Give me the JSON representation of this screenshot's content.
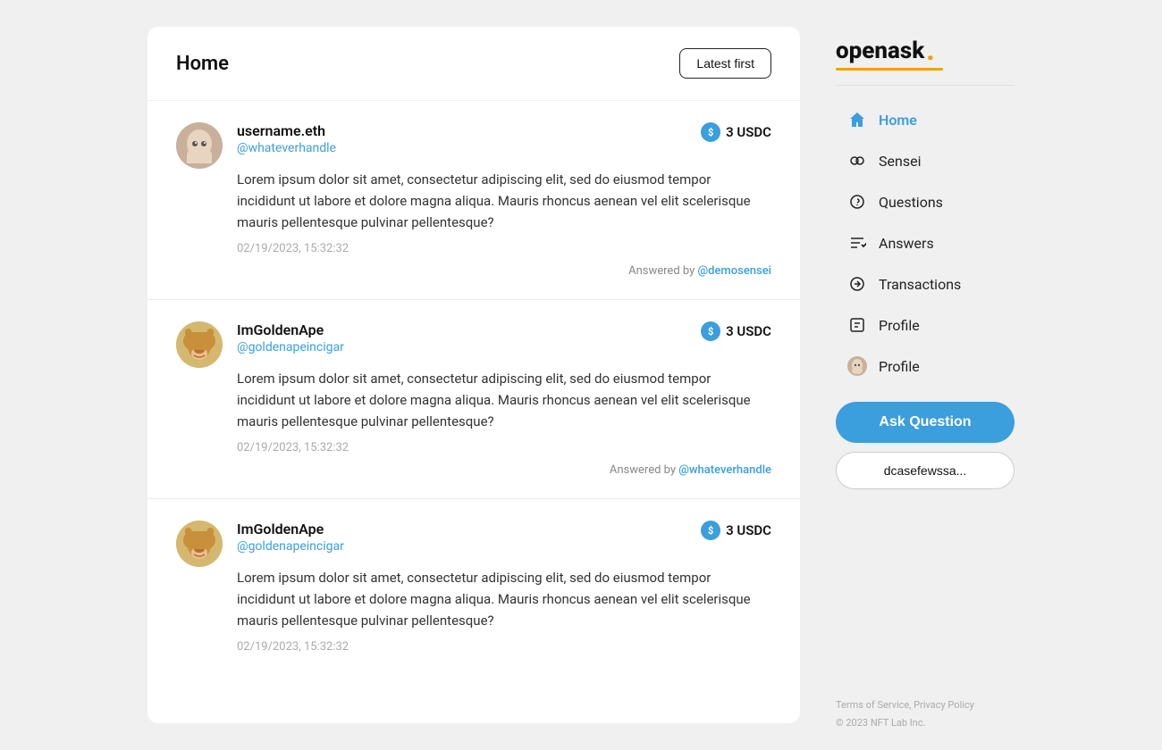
{
  "header": {
    "title": "Home",
    "sort_button": "Latest first"
  },
  "feed": {
    "items": [
      {
        "id": 1,
        "username": "username.eth",
        "handle": "@whateverhandle",
        "amount": "3 USDC",
        "avatar_type": "ghost",
        "text": "Lorem ipsum dolor sit amet, consectetur adipiscing elit, sed do eiusmod tempor incididunt ut labore et dolore magna aliqua. Mauris rhoncus aenean vel elit scelerisque mauris pellentesque pulvinar pellentesque?",
        "timestamp": "02/19/2023, 15:32:32",
        "answered_by": "@demosensei"
      },
      {
        "id": 2,
        "username": "ImGoldenApe",
        "handle": "@goldenapeincigar",
        "amount": "3 USDC",
        "avatar_type": "ape",
        "text": "Lorem ipsum dolor sit amet, consectetur adipiscing elit, sed do eiusmod tempor incididunt ut labore et dolore magna aliqua. Mauris rhoncus aenean vel elit scelerisque mauris pellentesque pulvinar pellentesque?",
        "timestamp": "02/19/2023, 15:32:32",
        "answered_by": "@whateverhandle"
      },
      {
        "id": 3,
        "username": "ImGoldenApe",
        "handle": "@goldenapeincigar",
        "amount": "3 USDC",
        "avatar_type": "ape",
        "text": "Lorem ipsum dolor sit amet, consectetur adipiscing elit, sed do eiusmod tempor incididunt ut labore et dolore magna aliqua. Mauris rhoncus aenean vel elit scelerisque mauris pellentesque pulvinar pellentesque?",
        "timestamp": "02/19/2023, 15:32:32",
        "answered_by": null
      }
    ]
  },
  "sidebar": {
    "logo": "openask",
    "logo_dot": ".",
    "nav_items": [
      {
        "id": "home",
        "label": "Home",
        "icon": "home",
        "active": true
      },
      {
        "id": "sensei",
        "label": "Sensei",
        "icon": "sensei",
        "active": false
      },
      {
        "id": "questions",
        "label": "Questions",
        "icon": "questions",
        "active": false
      },
      {
        "id": "answers",
        "label": "Answers",
        "icon": "answers",
        "active": false
      },
      {
        "id": "transactions",
        "label": "Transactions",
        "icon": "transactions",
        "active": false
      },
      {
        "id": "profile1",
        "label": "Profile",
        "icon": "profile",
        "active": false
      },
      {
        "id": "profile2",
        "label": "Profile",
        "icon": "avatar",
        "active": false
      }
    ],
    "ask_button": "Ask Question",
    "wallet_button": "dcasefewssa...",
    "footer": {
      "links": "Terms of Service, Privacy Policy",
      "copyright": "© 2023 NFT Lab Inc."
    }
  }
}
